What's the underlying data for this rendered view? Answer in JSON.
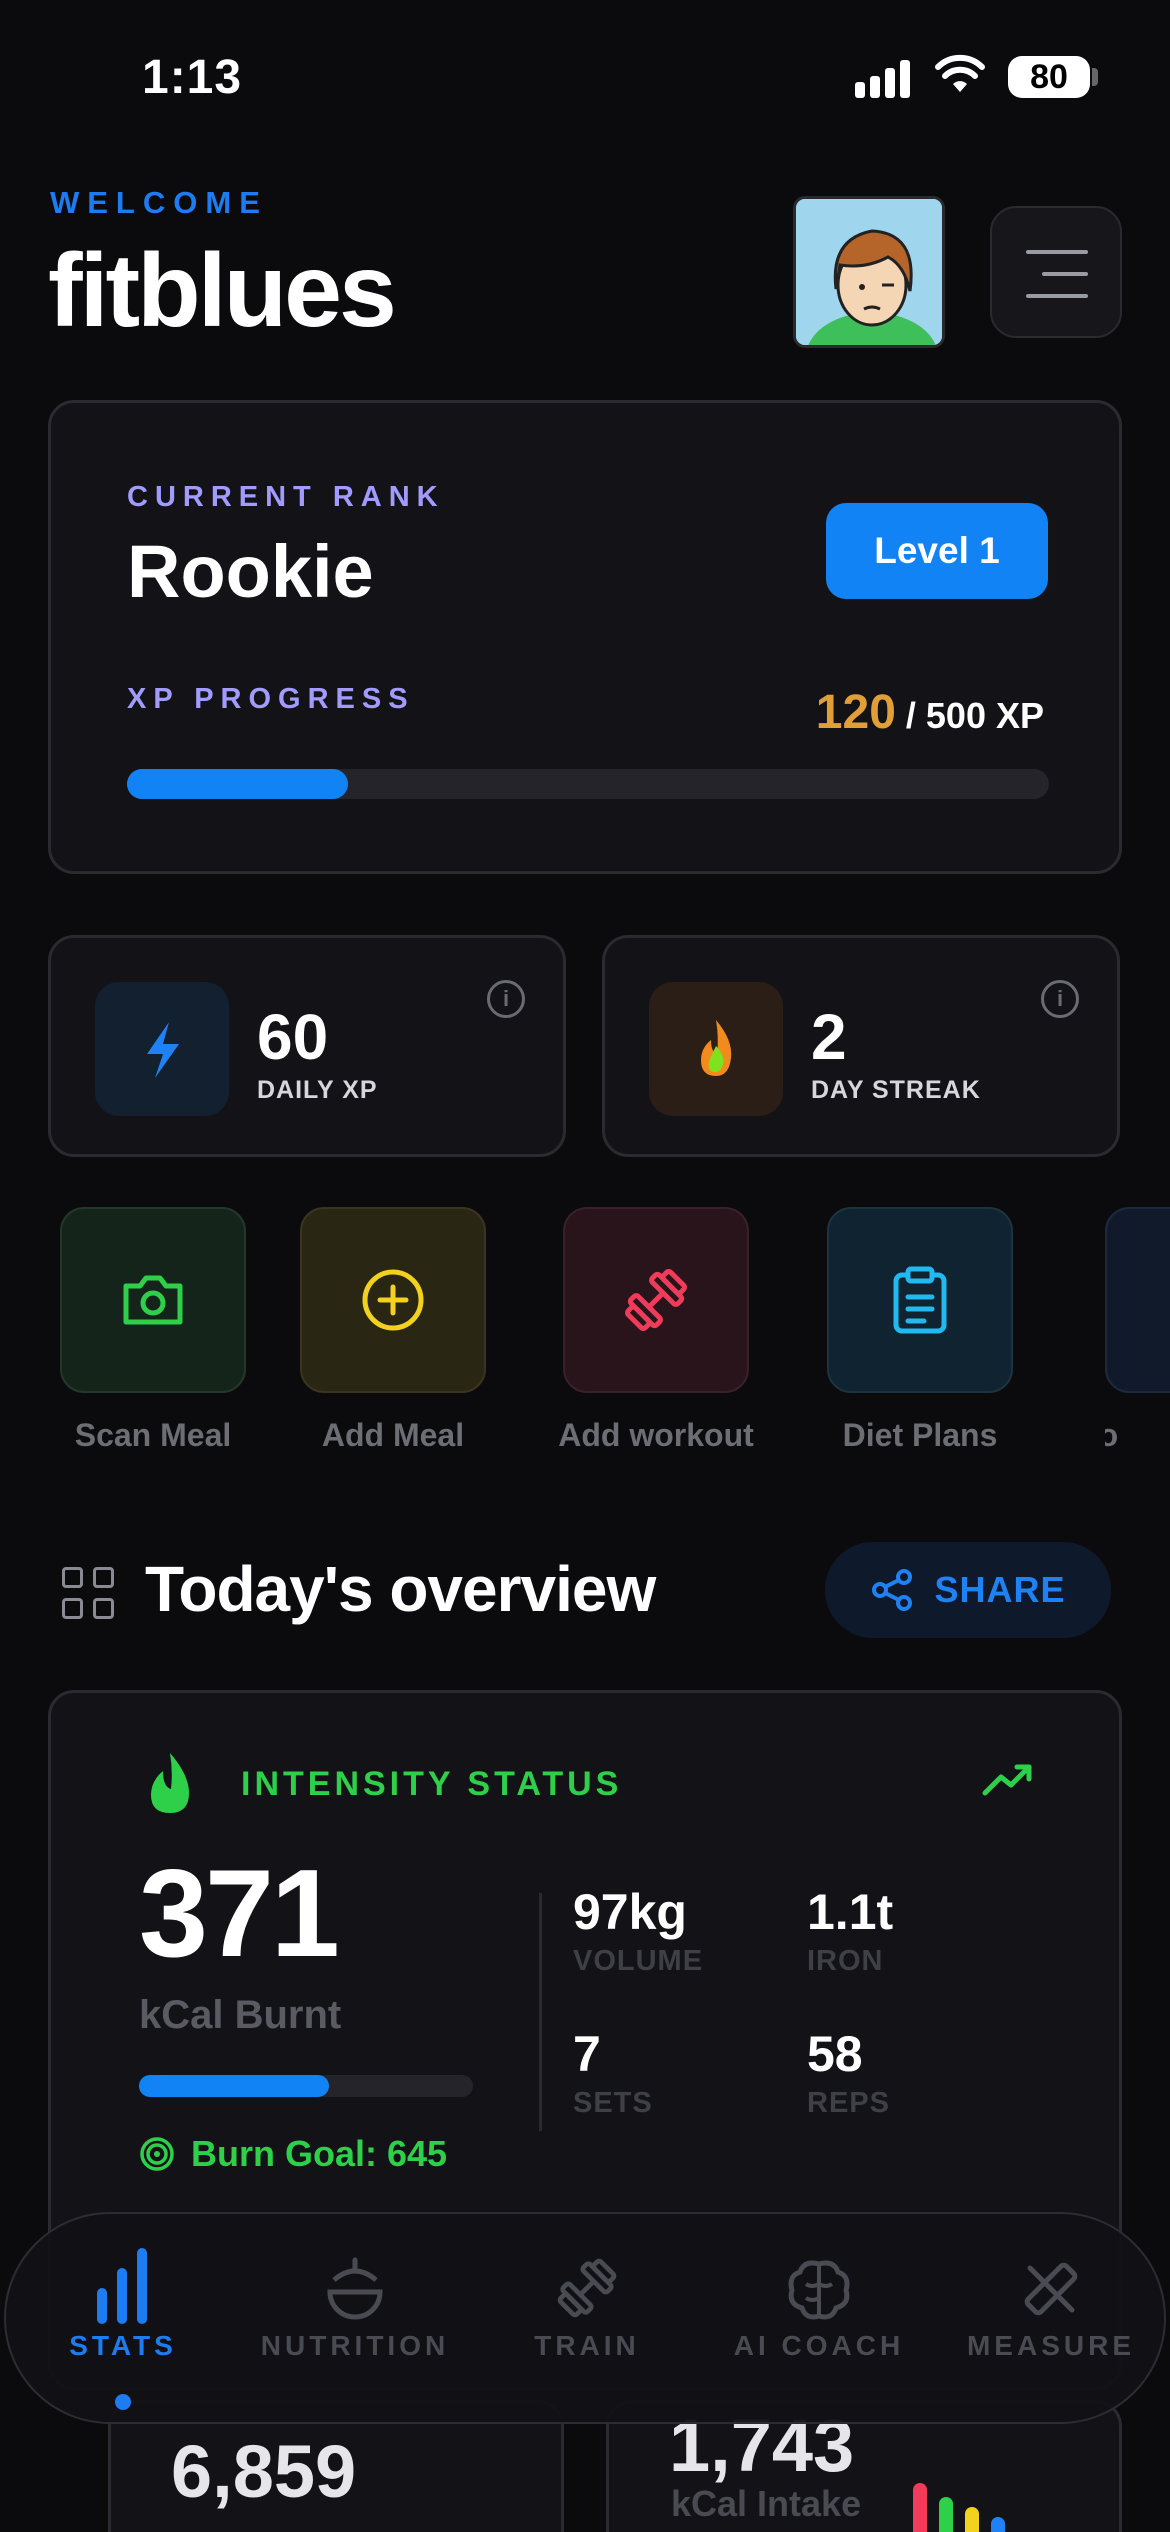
{
  "status_bar": {
    "time": "1:13",
    "battery": "80"
  },
  "header": {
    "welcome": "WELCOME",
    "username": "fitblues"
  },
  "rank_card": {
    "rank_label": "CURRENT RANK",
    "rank_name": "Rookie",
    "level_button": "Level 1",
    "xp_label": "XP PROGRESS",
    "xp_current": "120",
    "xp_total": " / 500 XP",
    "xp_progress_fraction": 0.24
  },
  "stats": {
    "daily_xp": {
      "value": "60",
      "label": "DAILY XP",
      "info": "i"
    },
    "streak": {
      "value": "2",
      "label": "DAY STREAK",
      "info": "i"
    }
  },
  "quick_actions": [
    {
      "label": "Scan Meal",
      "icon": "camera-icon",
      "color": "#2ed04a"
    },
    {
      "label": "Add Meal",
      "icon": "plus-circle-icon",
      "color": "#f2d21e"
    },
    {
      "label": "Add workout",
      "icon": "dumbbell-icon",
      "color": "#f23a5a"
    },
    {
      "label": "Diet Plans",
      "icon": "clipboard-icon",
      "color": "#22b8f0"
    },
    {
      "label": "Wo",
      "icon": "partial-icon",
      "color": "#1e7cf2"
    }
  ],
  "overview": {
    "title": "Today's overview",
    "share_label": "SHARE"
  },
  "intensity": {
    "label": "INTENSITY STATUS",
    "kcal_value": "371",
    "kcal_label": "kCal Burnt",
    "burn_progress_fraction": 0.57,
    "goal_text": "Burn Goal: 645",
    "metrics": [
      {
        "value": "97kg",
        "label": "VOLUME"
      },
      {
        "value": "1.1t",
        "label": "IRON"
      },
      {
        "value": "7",
        "label": "SETS"
      },
      {
        "value": "58",
        "label": "REPS"
      }
    ]
  },
  "lower_cards": {
    "left_value": "6,859",
    "right_value": "1,743",
    "right_label": "kCal Intake"
  },
  "tabbar": {
    "tabs": [
      {
        "label": "STATS",
        "icon": "bar-chart-icon",
        "active": true
      },
      {
        "label": "NUTRITION",
        "icon": "food-icon",
        "active": false
      },
      {
        "label": "TRAIN",
        "icon": "dumbbell-icon",
        "active": false
      },
      {
        "label": "AI COACH",
        "icon": "brain-icon",
        "active": false
      },
      {
        "label": "MEASURE",
        "icon": "ruler-icon",
        "active": false
      }
    ]
  },
  "colors": {
    "accent_blue": "#1283f5",
    "green": "#2ed04a",
    "purple": "#a29bff",
    "gold": "#e0a035"
  }
}
